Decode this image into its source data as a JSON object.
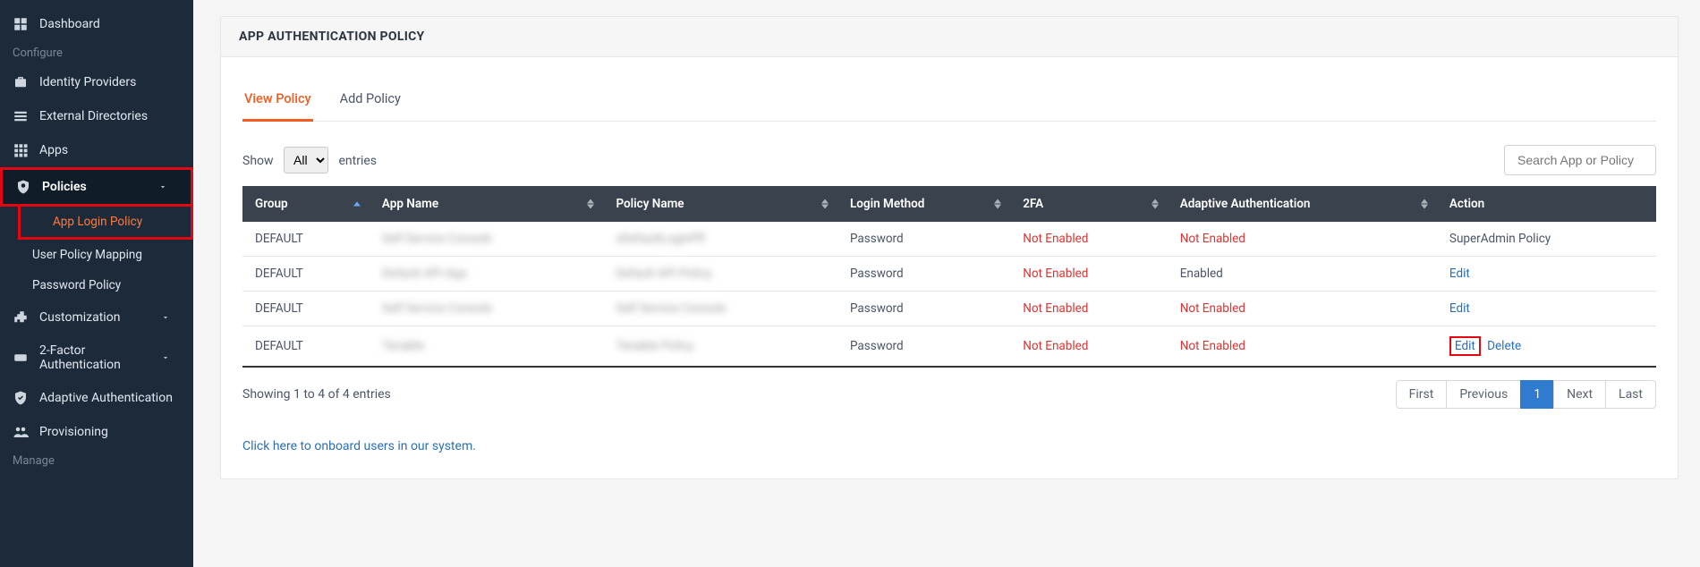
{
  "sidebar": {
    "dashboard": "Dashboard",
    "section_configure": "Configure",
    "identity_providers": "Identity Providers",
    "external_directories": "External Directories",
    "apps": "Apps",
    "policies": "Policies",
    "policies_sub": {
      "app_login": "App Login Policy",
      "user_policy_mapping": "User Policy Mapping",
      "password_policy": "Password Policy"
    },
    "customization": "Customization",
    "two_factor": "2-Factor Authentication",
    "adaptive_auth": "Adaptive Authentication",
    "provisioning": "Provisioning",
    "section_manage": "Manage"
  },
  "page": {
    "title": "APP AUTHENTICATION POLICY",
    "tabs": {
      "view": "View Policy",
      "add": "Add Policy"
    },
    "show_label_pre": "Show",
    "show_label_post": "entries",
    "show_option": "All",
    "search_placeholder": "Search App or Policy"
  },
  "table": {
    "headers": {
      "group": "Group",
      "app_name": "App Name",
      "policy_name": "Policy Name",
      "login_method": "Login Method",
      "tfa": "2FA",
      "adaptive": "Adaptive Authentication",
      "action": "Action"
    },
    "rows": [
      {
        "group": "DEFAULT",
        "app_name": "Self Service Console",
        "policy_name": "xDefaultLoginPfl",
        "login_method": "Password",
        "tfa": "Not Enabled",
        "adaptive": "Not Enabled",
        "action_primary": "SuperAdmin Policy",
        "action_secondary": ""
      },
      {
        "group": "DEFAULT",
        "app_name": "Default API App",
        "policy_name": "Default API Policy",
        "login_method": "Password",
        "tfa": "Not Enabled",
        "adaptive": "Enabled",
        "action_primary": "Edit",
        "action_secondary": ""
      },
      {
        "group": "DEFAULT",
        "app_name": "Self Service Console",
        "policy_name": "Self Service Console",
        "login_method": "Password",
        "tfa": "Not Enabled",
        "adaptive": "Not Enabled",
        "action_primary": "Edit",
        "action_secondary": ""
      },
      {
        "group": "DEFAULT",
        "app_name": "Tenable",
        "policy_name": "Tenable Policy",
        "login_method": "Password",
        "tfa": "Not Enabled",
        "adaptive": "Not Enabled",
        "action_primary": "Edit",
        "action_secondary": "Delete"
      }
    ]
  },
  "footer": {
    "info": "Showing 1 to 4 of 4 entries",
    "pager": {
      "first": "First",
      "prev": "Previous",
      "page1": "1",
      "next": "Next",
      "last": "Last"
    },
    "onboard_link": "Click here to onboard users in our system."
  }
}
